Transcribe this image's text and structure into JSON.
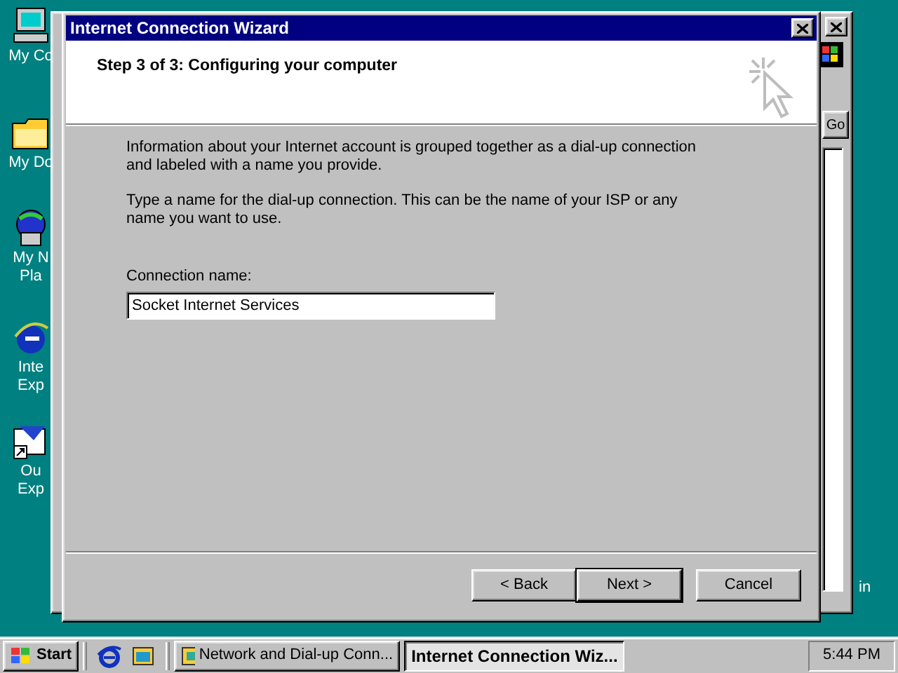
{
  "desktop_icons": [
    {
      "kind": "computer",
      "lines": [
        "My Co"
      ]
    },
    {
      "kind": "folder",
      "lines": [
        "My Do"
      ]
    },
    {
      "kind": "globe",
      "lines": [
        "My N",
        "Pla"
      ]
    },
    {
      "kind": "ie",
      "lines": [
        "Inte",
        "Exp"
      ]
    },
    {
      "kind": "mail",
      "lines": [
        "Ou",
        "Exp"
      ]
    }
  ],
  "background_window": {
    "go_button": "Go"
  },
  "desktop_text": "in",
  "wizard": {
    "title": "Internet Connection Wizard",
    "heading": "Step 3 of 3: Configuring your computer",
    "paragraphs": [
      "Information about your Internet account is grouped together as a dial-up connection and labeled with a name you provide.",
      "Type a name for the dial-up connection. This can be the name of your ISP or any name you want to use."
    ],
    "field_label": "Connection name:",
    "field_value": "Socket Internet Services",
    "buttons": [
      {
        "label": "< Back",
        "default": false
      },
      {
        "label": "Next >",
        "default": true
      },
      {
        "label": "Cancel",
        "default": false
      }
    ]
  },
  "taskbar": {
    "start": "Start",
    "tasks": [
      {
        "label": "Network and Dial-up Conn...",
        "selected": false
      },
      {
        "label": "Internet Connection Wiz...",
        "selected": true
      }
    ],
    "clock": "5:44 PM"
  }
}
